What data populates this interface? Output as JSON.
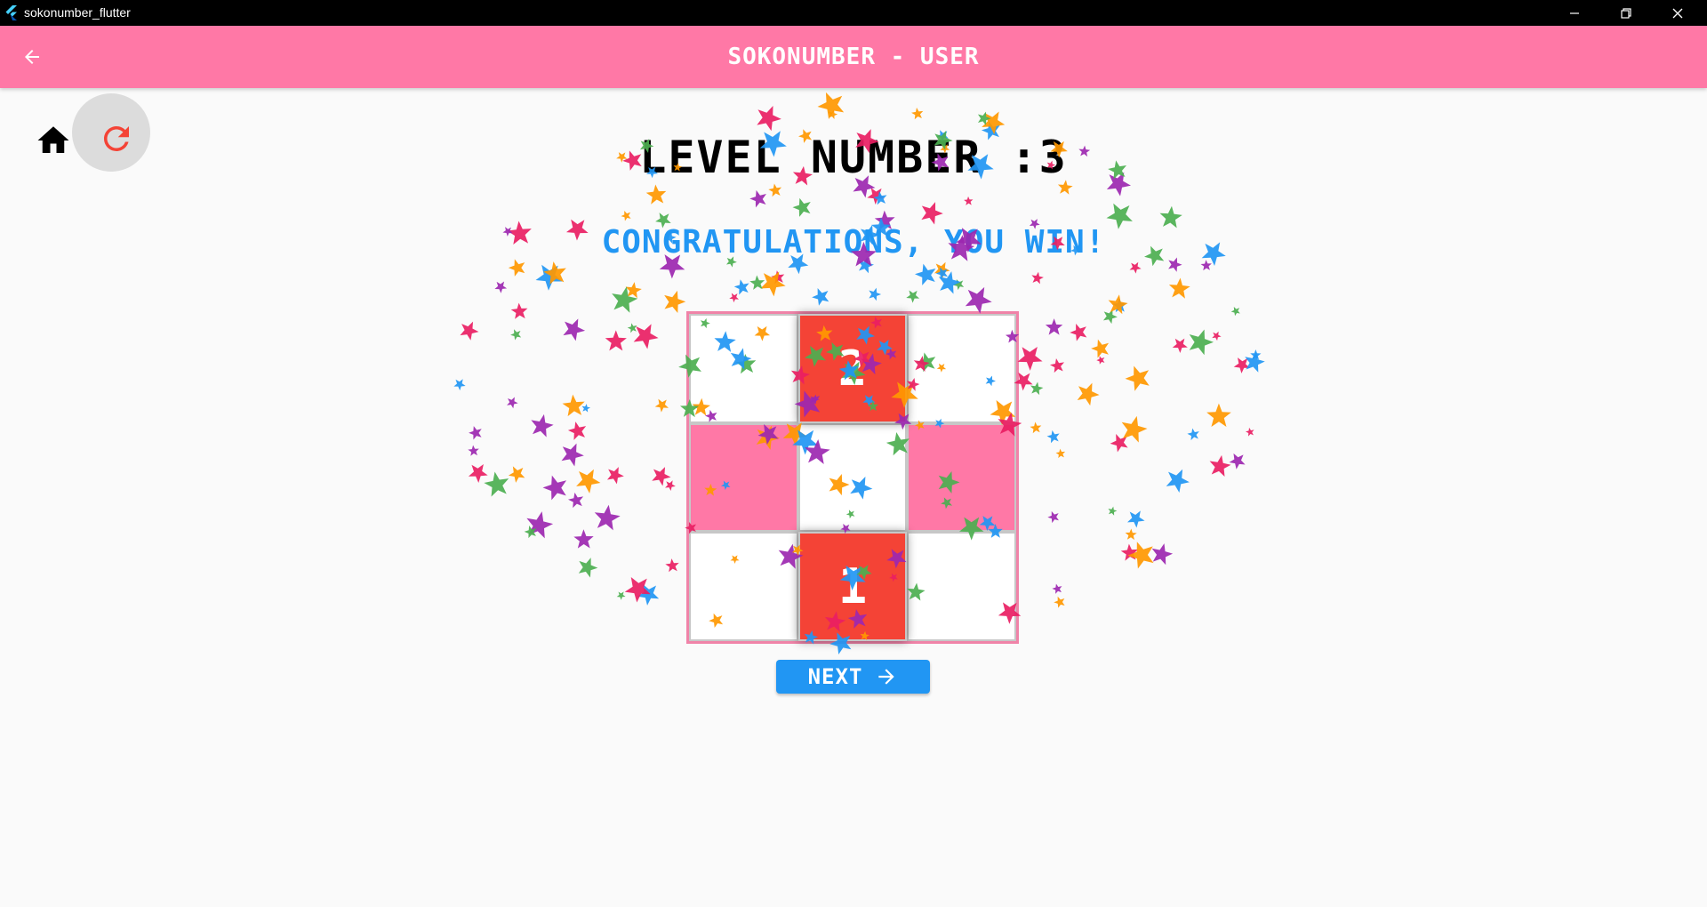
{
  "window": {
    "title": "sokonumber_flutter"
  },
  "appbar": {
    "title": "SOKONUMBER - USER",
    "color": "#ff78a6"
  },
  "controls": {
    "home_icon": "home-icon",
    "reload_icon": "refresh-icon",
    "reload_color": "#f44336"
  },
  "game": {
    "level_text": "LEVEL NUMBER :3",
    "message": "CONGRATULATIONS, YOU WIN!",
    "board": [
      [
        {
          "type": "empty",
          "value": ""
        },
        {
          "type": "block",
          "value": "2"
        },
        {
          "type": "empty",
          "value": ""
        }
      ],
      [
        {
          "type": "target",
          "value": ""
        },
        {
          "type": "empty",
          "value": ""
        },
        {
          "type": "target",
          "value": ""
        }
      ],
      [
        {
          "type": "empty",
          "value": ""
        },
        {
          "type": "block",
          "value": "1"
        },
        {
          "type": "empty",
          "value": ""
        }
      ]
    ],
    "colors": {
      "block": "#f44336",
      "target": "#ff78a6",
      "message": "#2196f3"
    }
  },
  "next_button": {
    "label": "NEXT",
    "icon": "arrow-right-icon",
    "color": "#2196f3"
  },
  "confetti": {
    "colors": [
      "#e91e63",
      "#9c27b0",
      "#2196f3",
      "#4caf50",
      "#ff9800"
    ]
  }
}
